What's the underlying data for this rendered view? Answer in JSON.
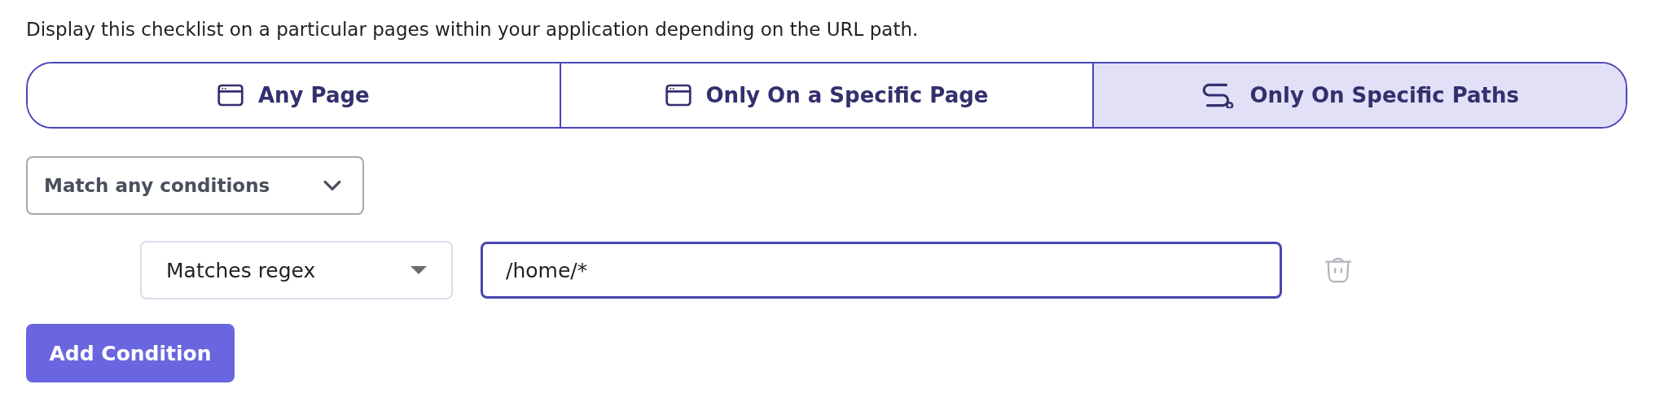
{
  "description": "Display this checklist on a particular pages within your application depending on the URL path.",
  "tabs": [
    {
      "label": "Any Page",
      "kind": "window",
      "selected": false
    },
    {
      "label": "Only On a Specific Page",
      "kind": "window",
      "selected": false
    },
    {
      "label": "Only On Specific Paths",
      "kind": "path",
      "selected": true
    }
  ],
  "match_select": {
    "value": "Match any conditions"
  },
  "conditions": [
    {
      "operator": "Matches regex",
      "value": "/home/*",
      "focused": true
    }
  ],
  "add_button": "Add Condition"
}
